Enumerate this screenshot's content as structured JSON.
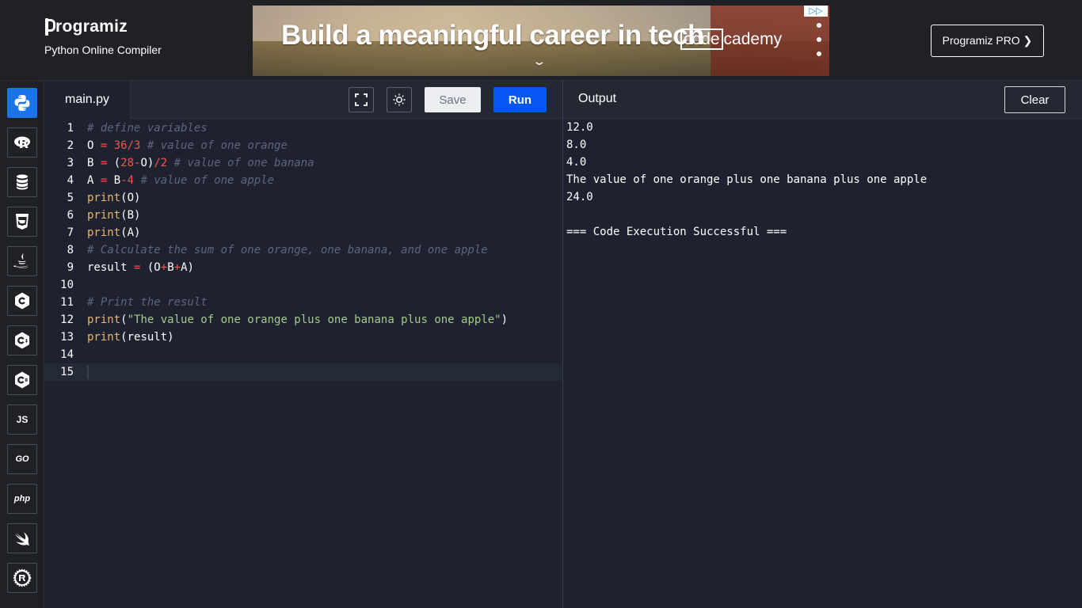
{
  "header": {
    "brand": "rogramiz",
    "subtitle": "Python Online Compiler",
    "ad_headline": "Build a meaningful career in tech",
    "ad_brand_code": "code",
    "ad_brand_rest": "cademy",
    "pro_button": "Programiz PRO ❯"
  },
  "sidebar": {
    "languages": [
      {
        "name": "python",
        "label": ""
      },
      {
        "name": "r",
        "label": ""
      },
      {
        "name": "sql",
        "label": ""
      },
      {
        "name": "html",
        "label": ""
      },
      {
        "name": "java",
        "label": ""
      },
      {
        "name": "c",
        "label": ""
      },
      {
        "name": "cpp",
        "label": ""
      },
      {
        "name": "csharp",
        "label": ""
      },
      {
        "name": "js",
        "label": "JS"
      },
      {
        "name": "go",
        "label": "GO"
      },
      {
        "name": "php",
        "label": "php"
      },
      {
        "name": "swift",
        "label": ""
      },
      {
        "name": "rust",
        "label": ""
      }
    ]
  },
  "editor": {
    "tab": "main.py",
    "save_label": "Save",
    "run_label": "Run",
    "line_numbers": [
      "1",
      "2",
      "3",
      "4",
      "5",
      "6",
      "7",
      "8",
      "9",
      "10",
      "11",
      "12",
      "13",
      "14",
      "15"
    ],
    "code": {
      "l1": "# define variables",
      "l2_a": "O ",
      "l2_b": "=",
      "l2_c": " ",
      "l2_d": "36",
      "l2_e": "/",
      "l2_f": "3",
      "l2_g": " ",
      "l2_h": "# value of one orange",
      "l3_a": "B ",
      "l3_b": "=",
      "l3_c": " (",
      "l3_d": "28",
      "l3_e": "-",
      "l3_f": "O)",
      "l3_g": "/",
      "l3_h": "2",
      "l3_i": " ",
      "l3_j": "# value of one banana",
      "l4_a": "A ",
      "l4_b": "=",
      "l4_c": " B",
      "l4_d": "-",
      "l4_e": "4",
      "l4_f": " ",
      "l4_g": "# value of one apple",
      "l5_a": "print",
      "l5_b": "(O)",
      "l6_a": "print",
      "l6_b": "(B)",
      "l7_a": "print",
      "l7_b": "(A)",
      "l8": "# Calculate the sum of one orange, one banana, and one apple",
      "l9_a": "result ",
      "l9_b": "=",
      "l9_c": " (O",
      "l9_d": "+",
      "l9_e": "B",
      "l9_f": "+",
      "l9_g": "A)",
      "l11": "# Print the result",
      "l12_a": "print",
      "l12_b": "(",
      "l12_c": "\"The value of one orange plus one banana plus one apple\"",
      "l12_d": ")",
      "l13_a": "print",
      "l13_b": "(result)"
    }
  },
  "output": {
    "title": "Output",
    "clear_label": "Clear",
    "lines": [
      "12.0",
      "8.0",
      "4.0",
      "The value of one orange plus one banana plus one apple",
      "24.0",
      "",
      "=== Code Execution Successful ==="
    ]
  },
  "colors": {
    "accent": "#0556f3",
    "background": "#1e2230",
    "comment": "#5f6678",
    "number": "#f0574a",
    "function": "#e6b673",
    "string": "#a6c98c"
  }
}
